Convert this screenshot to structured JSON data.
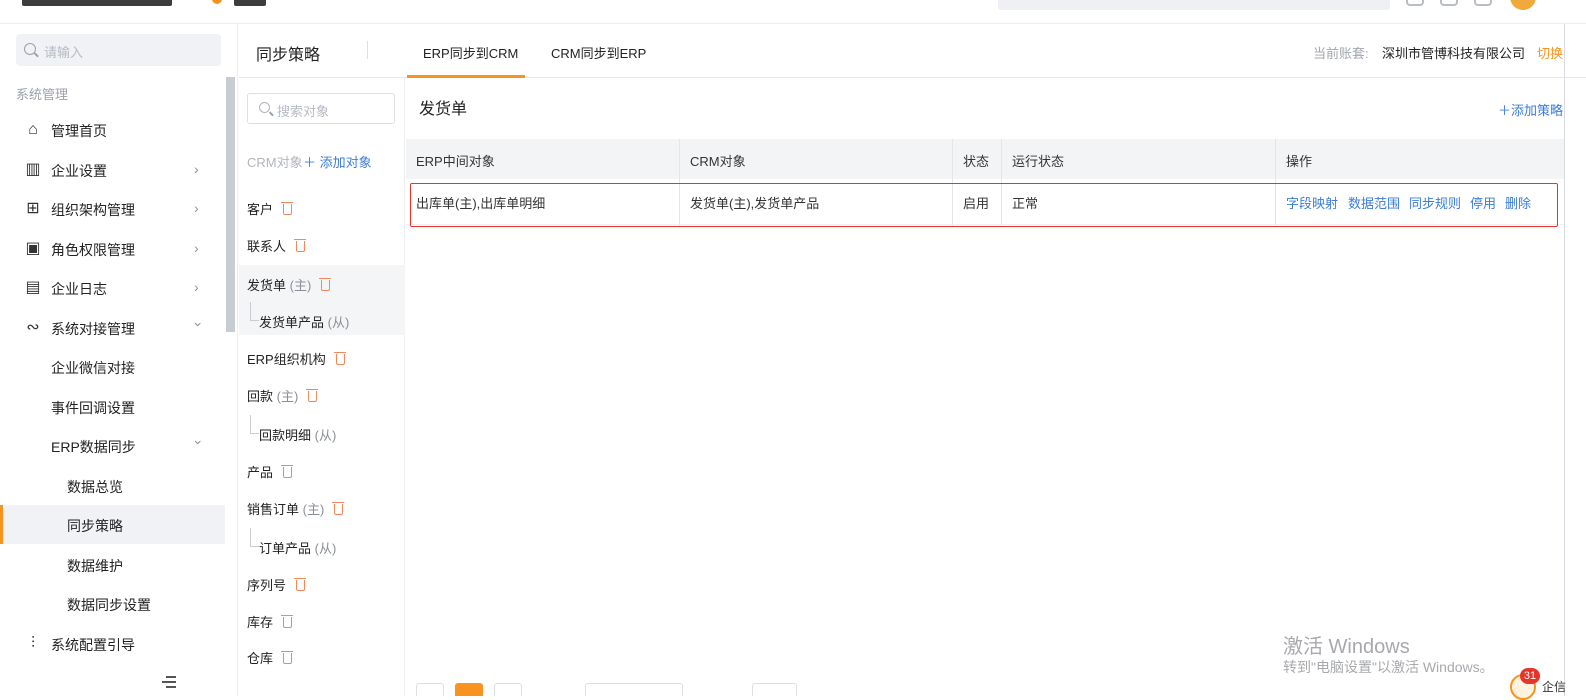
{
  "header": {
    "title": "同步策略",
    "tabs": [
      {
        "label": "ERP同步到CRM",
        "active": true
      },
      {
        "label": "CRM同步到ERP",
        "active": false
      }
    ],
    "account_label": "当前账套:",
    "account_value": "深圳市管博科技有限公司",
    "switch_label": "切换"
  },
  "sidebar": {
    "search_placeholder": "请输入",
    "section_label": "系统管理",
    "items": [
      {
        "label": "管理首页",
        "icon": "home-icon"
      },
      {
        "label": "企业设置",
        "icon": "building-icon"
      },
      {
        "label": "组织架构管理",
        "icon": "org-chart-icon"
      },
      {
        "label": "角色权限管理",
        "icon": "user-card-icon"
      },
      {
        "label": "企业日志",
        "icon": "log-icon"
      },
      {
        "label": "系统对接管理",
        "icon": "link-icon"
      },
      {
        "label": "企业微信对接"
      },
      {
        "label": "事件回调设置"
      },
      {
        "label": "ERP数据同步"
      },
      {
        "label": "数据总览"
      },
      {
        "label": "同步策略",
        "active": true
      },
      {
        "label": "数据维护"
      },
      {
        "label": "数据同步设置"
      },
      {
        "label": "系统配置引导",
        "icon": "sliders-icon"
      }
    ]
  },
  "objects": {
    "search_placeholder": "搜索对象",
    "crm_label": "CRM对象",
    "add_label": "添加对象",
    "list": [
      {
        "name": "客户",
        "tag": ""
      },
      {
        "name": "联系人",
        "tag": ""
      },
      {
        "name": "发货单",
        "tag": "(主)"
      },
      {
        "name": "发货单产品",
        "tag": "(从)"
      },
      {
        "name": "ERP组织机构",
        "tag": ""
      },
      {
        "name": "回款",
        "tag": "(主)"
      },
      {
        "name": "回款明细",
        "tag": "(从)"
      },
      {
        "name": "产品",
        "tag": ""
      },
      {
        "name": "销售订单",
        "tag": "(主)"
      },
      {
        "name": "订单产品",
        "tag": "(从)"
      },
      {
        "name": "序列号",
        "tag": ""
      },
      {
        "name": "库存",
        "tag": ""
      },
      {
        "name": "仓库",
        "tag": ""
      }
    ]
  },
  "main": {
    "title": "发货单",
    "add_strategy_label": "添加策略",
    "columns": [
      "ERP中间对象",
      "CRM对象",
      "状态",
      "运行状态",
      "操作"
    ],
    "rows": [
      {
        "erp_object": "出库单(主),出库单明细",
        "crm_object": "发货单(主),发货单产品",
        "status": "启用",
        "run_status": "正常",
        "actions": [
          "字段映射",
          "数据范围",
          "同步规则",
          "停用",
          "删除"
        ]
      }
    ]
  },
  "watermark": {
    "line1": "激活 Windows",
    "line2": "转到\"电脑设置\"以激活 Windows。"
  },
  "notification": {
    "count": "31",
    "text": "企信"
  },
  "colors": {
    "accent": "#f7931e",
    "link": "#3b7ddd",
    "highlight": "#e8332a"
  }
}
